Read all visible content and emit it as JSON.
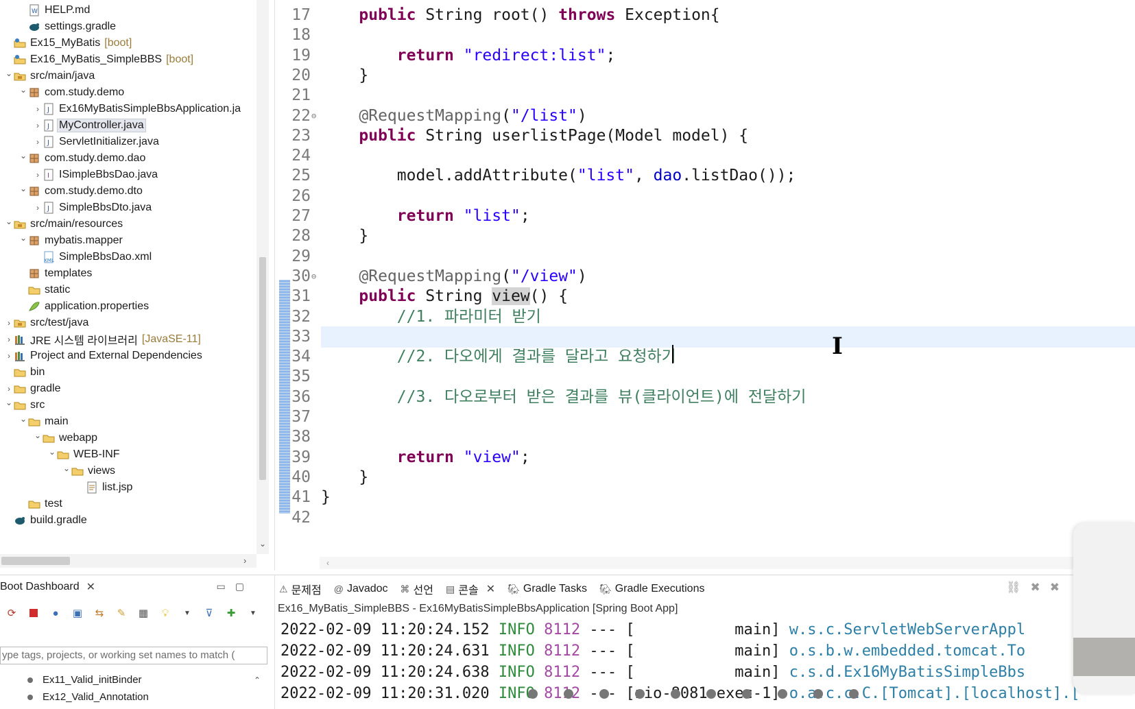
{
  "explorer": {
    "items": [
      {
        "label": "HELP.md",
        "deco": "",
        "icon": "markdown-file-icon",
        "level": 1,
        "chev": ""
      },
      {
        "label": "settings.gradle",
        "deco": "",
        "icon": "gradle-file-icon",
        "level": 1,
        "chev": ""
      },
      {
        "label": "Ex15_MyBatis",
        "deco": "[boot]",
        "icon": "project-icon",
        "level": 0,
        "chev": ""
      },
      {
        "label": "Ex16_MyBatis_SimpleBBS",
        "deco": "[boot]",
        "icon": "project-icon",
        "level": 0,
        "chev": ""
      },
      {
        "label": "src/main/java",
        "deco": "",
        "icon": "source-folder-icon",
        "level": 0,
        "chev": "open"
      },
      {
        "label": "com.study.demo",
        "deco": "",
        "icon": "package-icon",
        "level": 1,
        "chev": "open"
      },
      {
        "label": "Ex16MyBatisSimpleBbsApplication.ja",
        "deco": "",
        "icon": "java-file-icon",
        "level": 2,
        "chev": "closed"
      },
      {
        "label": "MyController.java",
        "deco": "",
        "icon": "java-file-icon",
        "level": 2,
        "chev": "closed",
        "selected": true
      },
      {
        "label": "ServletInitializer.java",
        "deco": "",
        "icon": "java-file-icon",
        "level": 2,
        "chev": "closed"
      },
      {
        "label": "com.study.demo.dao",
        "deco": "",
        "icon": "package-icon",
        "level": 1,
        "chev": "open"
      },
      {
        "label": "ISimpleBbsDao.java",
        "deco": "",
        "icon": "java-interface-icon",
        "level": 2,
        "chev": "closed"
      },
      {
        "label": "com.study.demo.dto",
        "deco": "",
        "icon": "package-icon",
        "level": 1,
        "chev": "open"
      },
      {
        "label": "SimpleBbsDto.java",
        "deco": "",
        "icon": "java-file-icon",
        "level": 2,
        "chev": "closed"
      },
      {
        "label": "src/main/resources",
        "deco": "",
        "icon": "source-folder-icon",
        "level": 0,
        "chev": "open"
      },
      {
        "label": "mybatis.mapper",
        "deco": "",
        "icon": "package-icon",
        "level": 1,
        "chev": "open"
      },
      {
        "label": "SimpleBbsDao.xml",
        "deco": "",
        "icon": "xml-file-icon",
        "level": 2,
        "chev": ""
      },
      {
        "label": "templates",
        "deco": "",
        "icon": "package-icon",
        "level": 1,
        "chev": ""
      },
      {
        "label": "static",
        "deco": "",
        "icon": "folder-icon",
        "level": 1,
        "chev": ""
      },
      {
        "label": "application.properties",
        "deco": "",
        "icon": "properties-file-icon",
        "level": 1,
        "chev": ""
      },
      {
        "label": "src/test/java",
        "deco": "",
        "icon": "source-folder-icon",
        "level": 0,
        "chev": "closed"
      },
      {
        "label": "JRE 시스템 라이브러리",
        "deco": "[JavaSE-11]",
        "icon": "library-icon",
        "level": 0,
        "chev": "closed"
      },
      {
        "label": "Project and External Dependencies",
        "deco": "",
        "icon": "library-icon",
        "level": 0,
        "chev": "closed"
      },
      {
        "label": "bin",
        "deco": "",
        "icon": "folder-icon",
        "level": 0,
        "chev": ""
      },
      {
        "label": "gradle",
        "deco": "",
        "icon": "folder-icon",
        "level": 0,
        "chev": "closed"
      },
      {
        "label": "src",
        "deco": "",
        "icon": "folder-icon",
        "level": 0,
        "chev": "open"
      },
      {
        "label": "main",
        "deco": "",
        "icon": "folder-icon",
        "level": 1,
        "chev": "open"
      },
      {
        "label": "webapp",
        "deco": "",
        "icon": "folder-icon",
        "level": 2,
        "chev": "open"
      },
      {
        "label": "WEB-INF",
        "deco": "",
        "icon": "folder-icon",
        "level": 3,
        "chev": "open"
      },
      {
        "label": "views",
        "deco": "",
        "icon": "folder-icon",
        "level": 4,
        "chev": "open"
      },
      {
        "label": "list.jsp",
        "deco": "",
        "icon": "jsp-file-icon",
        "level": 5,
        "chev": ""
      },
      {
        "label": "test",
        "deco": "",
        "icon": "folder-icon",
        "level": 1,
        "chev": ""
      },
      {
        "label": "build.gradle",
        "deco": "",
        "icon": "gradle-file-icon",
        "level": 0,
        "chev": ""
      }
    ]
  },
  "boot": {
    "tab_label": "Boot Dashboard",
    "filter_placeholder": "ype tags, projects, or working set names to match (",
    "items": [
      "Ex11_Valid_initBinder",
      "Ex12_Valid_Annotation"
    ]
  },
  "editor": {
    "lines": [
      {
        "n": "17",
        "fold": "",
        "tokens": [
          {
            "t": "    "
          },
          {
            "t": "public",
            "c": "kw"
          },
          {
            "t": " String root() "
          },
          {
            "t": "throws",
            "c": "kw"
          },
          {
            "t": " Exception{"
          }
        ]
      },
      {
        "n": "18",
        "fold": "",
        "tokens": []
      },
      {
        "n": "19",
        "fold": "",
        "tokens": [
          {
            "t": "        "
          },
          {
            "t": "return",
            "c": "kw"
          },
          {
            "t": " "
          },
          {
            "t": "\"redirect:list\"",
            "c": "str"
          },
          {
            "t": ";"
          }
        ]
      },
      {
        "n": "20",
        "fold": "",
        "tokens": [
          {
            "t": "    }"
          }
        ]
      },
      {
        "n": "21",
        "fold": "",
        "tokens": []
      },
      {
        "n": "22",
        "fold": "⊖",
        "tokens": [
          {
            "t": "    "
          },
          {
            "t": "@RequestMapping",
            "c": "ann"
          },
          {
            "t": "("
          },
          {
            "t": "\"/list\"",
            "c": "str"
          },
          {
            "t": ")"
          }
        ]
      },
      {
        "n": "23",
        "fold": "",
        "tokens": [
          {
            "t": "    "
          },
          {
            "t": "public",
            "c": "kw"
          },
          {
            "t": " String userlistPage(Model model) {"
          }
        ]
      },
      {
        "n": "24",
        "fold": "",
        "tokens": []
      },
      {
        "n": "25",
        "fold": "",
        "tokens": [
          {
            "t": "        model.addAttribute("
          },
          {
            "t": "\"list\"",
            "c": "str"
          },
          {
            "t": ", "
          },
          {
            "t": "dao",
            "c": "fld"
          },
          {
            "t": ".listDao());"
          }
        ]
      },
      {
        "n": "26",
        "fold": "",
        "tokens": []
      },
      {
        "n": "27",
        "fold": "",
        "tokens": [
          {
            "t": "        "
          },
          {
            "t": "return",
            "c": "kw"
          },
          {
            "t": " "
          },
          {
            "t": "\"list\"",
            "c": "str"
          },
          {
            "t": ";"
          }
        ]
      },
      {
        "n": "28",
        "fold": "",
        "tokens": [
          {
            "t": "    }"
          }
        ]
      },
      {
        "n": "29",
        "fold": "",
        "tokens": []
      },
      {
        "n": "30",
        "fold": "⊖",
        "tokens": [
          {
            "t": "    "
          },
          {
            "t": "@RequestMapping",
            "c": "ann"
          },
          {
            "t": "("
          },
          {
            "t": "\"/view\"",
            "c": "str"
          },
          {
            "t": ")"
          }
        ]
      },
      {
        "n": "31",
        "fold": "",
        "tokens": [
          {
            "t": "    "
          },
          {
            "t": "public",
            "c": "kw"
          },
          {
            "t": " String "
          },
          {
            "t": "view",
            "c": "hl"
          },
          {
            "t": "() {"
          }
        ]
      },
      {
        "n": "32",
        "fold": "",
        "tokens": [
          {
            "t": "        "
          },
          {
            "t": "//1. 파라미터 받기",
            "c": "cm"
          }
        ]
      },
      {
        "n": "33",
        "fold": "",
        "tokens": [],
        "current": true
      },
      {
        "n": "34",
        "fold": "",
        "tokens": [
          {
            "t": "        "
          },
          {
            "t": "//2. 다오에게 결과를 달라고 요청하기",
            "c": "cm"
          }
        ]
      },
      {
        "n": "35",
        "fold": "",
        "tokens": []
      },
      {
        "n": "36",
        "fold": "",
        "tokens": [
          {
            "t": "        "
          },
          {
            "t": "//3. 다오로부터 받은 결과를 뷰(클라이언트)에 전달하기",
            "c": "cm"
          }
        ]
      },
      {
        "n": "37",
        "fold": "",
        "tokens": []
      },
      {
        "n": "38",
        "fold": "",
        "tokens": []
      },
      {
        "n": "39",
        "fold": "",
        "tokens": [
          {
            "t": "        "
          },
          {
            "t": "return",
            "c": "kw"
          },
          {
            "t": " "
          },
          {
            "t": "\"view\"",
            "c": "str"
          },
          {
            "t": ";"
          }
        ]
      },
      {
        "n": "40",
        "fold": "",
        "tokens": [
          {
            "t": "    }"
          }
        ]
      },
      {
        "n": "41",
        "fold": "",
        "tokens": [
          {
            "t": "}"
          }
        ]
      },
      {
        "n": "42",
        "fold": "",
        "tokens": []
      }
    ]
  },
  "console": {
    "tabs": [
      {
        "label": "문제점",
        "icon": "problems-icon"
      },
      {
        "label": "Javadoc",
        "icon": "at-icon"
      },
      {
        "label": "선언",
        "icon": "declaration-icon"
      },
      {
        "label": "콘솔",
        "icon": "console-icon",
        "active": true
      },
      {
        "label": "Gradle Tasks",
        "icon": "gradle-icon"
      },
      {
        "label": "Gradle Executions",
        "icon": "gradle-icon"
      }
    ],
    "title": "Ex16_MyBatis_SimpleBBS - Ex16MyBatisSimpleBbsApplication [Spring Boot App]",
    "lines": [
      {
        "date": "2022-02-09 11:20:24.152",
        "level": "INFO",
        "pid": "8112",
        "sep": "---",
        "thread": "[           main]",
        "cls": "w.s.c.ServletWebServerAppl"
      },
      {
        "date": "2022-02-09 11:20:24.631",
        "level": "INFO",
        "pid": "8112",
        "sep": "---",
        "thread": "[           main]",
        "cls": "o.s.b.w.embedded.tomcat.To"
      },
      {
        "date": "2022-02-09 11:20:24.638",
        "level": "INFO",
        "pid": "8112",
        "sep": "---",
        "thread": "[           main]",
        "cls": "c.s.d.Ex16MyBatisSimpleBbs"
      },
      {
        "date": "2022-02-09 11:20:31.020",
        "level": "INFO",
        "pid": "8112",
        "sep": "---",
        "thread": "[nio-8081-exec-1]",
        "cls": "o.a.c.c.C.[Tomcat].[localhost].["
      }
    ]
  },
  "colors": {
    "keyword": "#7f0055",
    "string": "#2a00ff",
    "comment": "#3f7f5f",
    "annotation": "#646464",
    "field": "#0000c0",
    "log_info": "#2f8a3c",
    "log_class": "#2d7fa6"
  }
}
